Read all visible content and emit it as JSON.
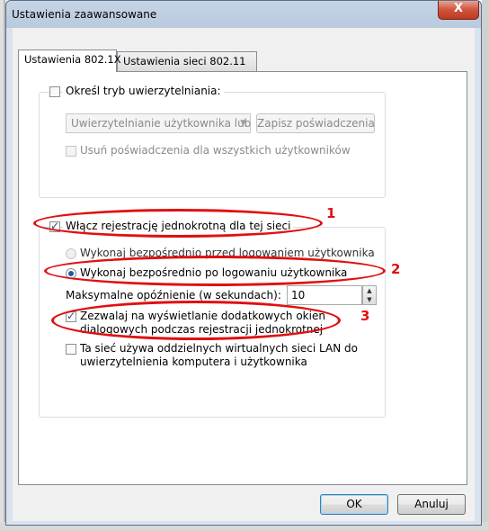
{
  "window": {
    "title": "Ustawienia zaawansowane",
    "close_glyph": "X"
  },
  "tabs": [
    {
      "label": "Ustawienia 802.1X",
      "active": true
    },
    {
      "label": "Ustawienia sieci 802.11",
      "active": false
    }
  ],
  "auth_group": {
    "checkbox_label": "Określ tryb uwierzytelniania:",
    "checked": false,
    "mode_select_value": "Uwierzytelnianie użytkownika lub",
    "save_credentials_label": "Zapisz poświadczenia",
    "delete_credentials_label": "Usuń poświadczenia dla wszystkich użytkowników"
  },
  "sso_group": {
    "enable_label": "Włącz rejestrację jednokrotną dla tej sieci",
    "enable_checked": true,
    "radio_before_label": "Wykonaj bezpośrednio przed logowaniem użytkownika",
    "radio_after_label": "Wykonaj bezpośrednio po logowaniu użytkownika",
    "selected_radio": "after",
    "max_delay_label": "Maksymalne opóźnienie (w sekundach):",
    "max_delay_value": "10",
    "allow_dialogs_label_line1": "Zezwalaj na wyświetlanie dodatkowych okien",
    "allow_dialogs_label_line2": "dialogowych podczas rejestracji jednokrotnej",
    "allow_dialogs_checked": true,
    "separate_vlan_label_line1": "Ta sieć używa oddzielnych wirtualnych sieci LAN do",
    "separate_vlan_label_line2": "uwierzytelnienia komputera i użytkownika",
    "separate_vlan_checked": false
  },
  "annotations": [
    "1",
    "2",
    "3"
  ],
  "buttons": {
    "ok": "OK",
    "cancel": "Anuluj"
  },
  "colors": {
    "annotation": "#e01010",
    "close_button": "#c0391f"
  }
}
